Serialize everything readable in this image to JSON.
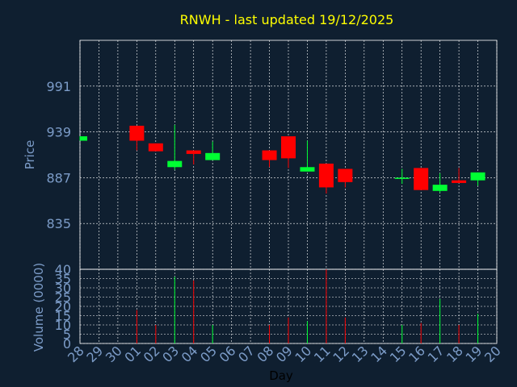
{
  "colors": {
    "background": "#0f1f30",
    "up": "#00ff33",
    "down": "#ff0000",
    "grid": "#ffffff",
    "tick_text": "#7c9cc8",
    "title": "#ffff00",
    "xlabel": "#000000"
  },
  "chart_data": [
    {
      "type": "candlestick",
      "title": "RNWH - last updated 19/12/2025",
      "ylabel": "Price",
      "ylim": [
        783,
        1043
      ],
      "yticks": [
        835,
        887,
        939,
        991
      ],
      "ytick_labels": [
        "835",
        "887",
        "939",
        "991"
      ],
      "grid": true,
      "candles": [
        {
          "day": "28",
          "open": 929,
          "close": 934,
          "high": 934,
          "low": 929
        },
        {
          "day": "01",
          "open": 946,
          "close": 929,
          "high": 946,
          "low": 918
        },
        {
          "day": "02",
          "open": 926,
          "close": 917,
          "high": 926,
          "low": 917
        },
        {
          "day": "03",
          "open": 899,
          "close": 906,
          "high": 947,
          "low": 896
        },
        {
          "day": "04",
          "open": 918,
          "close": 914,
          "high": 918,
          "low": 902
        },
        {
          "day": "05",
          "open": 907,
          "close": 915,
          "high": 928,
          "low": 907
        },
        {
          "day": "08",
          "open": 918,
          "close": 907,
          "high": 918,
          "low": 899
        },
        {
          "day": "09",
          "open": 934,
          "close": 909,
          "high": 934,
          "low": 898
        },
        {
          "day": "10",
          "open": 894,
          "close": 899,
          "high": 929,
          "low": 894
        },
        {
          "day": "11",
          "open": 903,
          "close": 876,
          "high": 903,
          "low": 869
        },
        {
          "day": "12",
          "open": 897,
          "close": 882,
          "high": 897,
          "low": 876
        },
        {
          "day": "15",
          "open": 886,
          "close": 887,
          "high": 897,
          "low": 880
        },
        {
          "day": "16",
          "open": 898,
          "close": 873,
          "high": 898,
          "low": 873
        },
        {
          "day": "17",
          "open": 872,
          "close": 879,
          "high": 892,
          "low": 870
        },
        {
          "day": "18",
          "open": 884,
          "close": 881,
          "high": 898,
          "low": 881
        },
        {
          "day": "19",
          "open": 884,
          "close": 893,
          "high": 893,
          "low": 878
        }
      ]
    },
    {
      "type": "bar",
      "ylabel": "Volume (0000)",
      "xlabel": "Day",
      "ylim": [
        0,
        40
      ],
      "yticks": [
        0,
        5,
        10,
        15,
        20,
        25,
        30,
        35,
        40
      ],
      "ytick_labels": [
        "0",
        "5",
        "10",
        "15",
        "20",
        "25",
        "30",
        "35",
        "40"
      ],
      "x_tick_labels": [
        "28",
        "29",
        "30",
        "01",
        "02",
        "03",
        "04",
        "05",
        "06",
        "07",
        "08",
        "09",
        "10",
        "11",
        "12",
        "13",
        "14",
        "15",
        "16",
        "17",
        "18",
        "19",
        "20"
      ],
      "bars": [
        {
          "day": "28",
          "value": 0,
          "direction": "up"
        },
        {
          "day": "01",
          "value": 18,
          "direction": "down"
        },
        {
          "day": "02",
          "value": 10,
          "direction": "down"
        },
        {
          "day": "03",
          "value": 36,
          "direction": "up"
        },
        {
          "day": "04",
          "value": 34,
          "direction": "down"
        },
        {
          "day": "05",
          "value": 10,
          "direction": "up"
        },
        {
          "day": "08",
          "value": 10,
          "direction": "down"
        },
        {
          "day": "09",
          "value": 14,
          "direction": "down"
        },
        {
          "day": "10",
          "value": 12,
          "direction": "up"
        },
        {
          "day": "11",
          "value": 40,
          "direction": "down"
        },
        {
          "day": "12",
          "value": 14,
          "direction": "down"
        },
        {
          "day": "15",
          "value": 10,
          "direction": "up"
        },
        {
          "day": "16",
          "value": 11,
          "direction": "down"
        },
        {
          "day": "17",
          "value": 24,
          "direction": "up"
        },
        {
          "day": "18",
          "value": 10,
          "direction": "down"
        },
        {
          "day": "19",
          "value": 16,
          "direction": "up"
        }
      ]
    }
  ]
}
